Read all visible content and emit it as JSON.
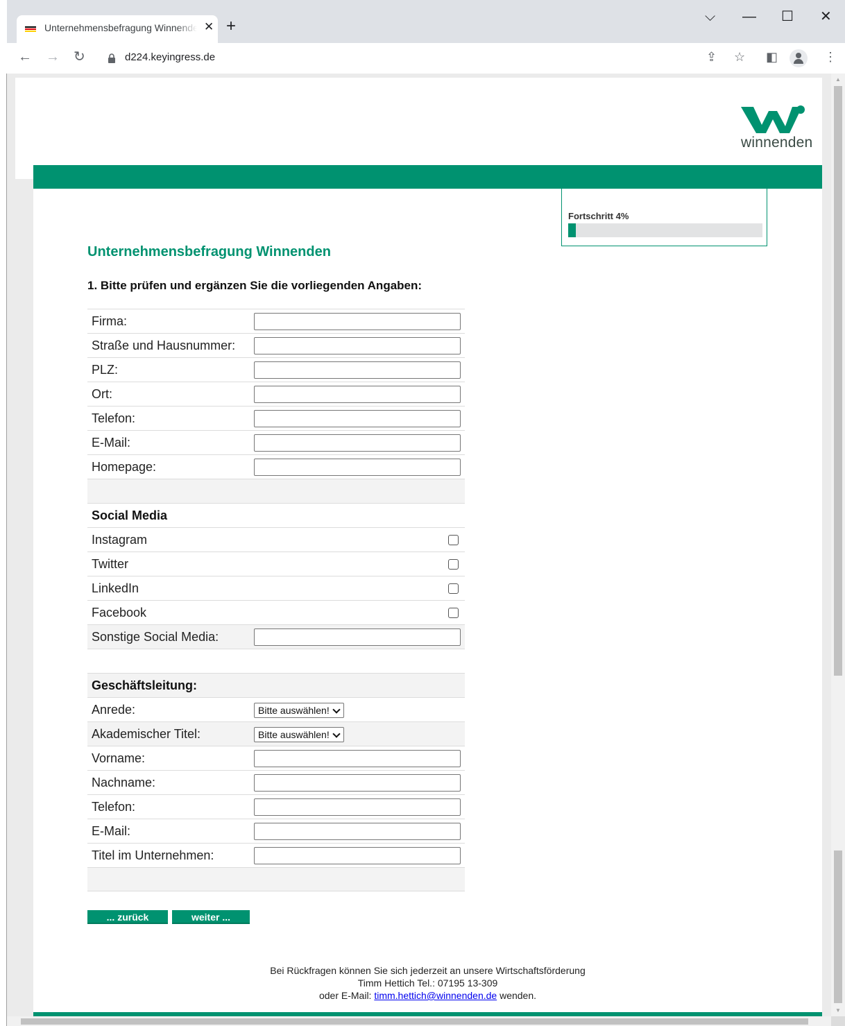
{
  "browser": {
    "tab_title": "Unternehmensbefragung Winnenden",
    "tab_close": "✕",
    "new_tab": "+",
    "url": "d224.keyingress.de",
    "window_controls": {
      "dropdown": "⌵",
      "minimize": "—",
      "maximize": "☐",
      "close": "✕"
    },
    "nav": {
      "back": "←",
      "forward": "→",
      "reload": "↻"
    },
    "toolbar_icons": {
      "share": "⇪",
      "bookmark": "☆",
      "sidepanel": "◧",
      "menu": "⋮"
    }
  },
  "logo": {
    "text": "winnenden",
    "icon": "winnenden-w-logo",
    "color": "#009270"
  },
  "progress": {
    "label": "Fortschritt 4%",
    "value": 0.04
  },
  "survey_title": "Unternehmensbefragung Winnenden",
  "question": "1. Bitte prüfen und ergänzen Sie die vorliegenden Angaben:",
  "company": {
    "fields": [
      "Firma:",
      "Straße und Hausnummer:",
      "PLZ:",
      "Ort:",
      "Telefon:",
      "E-Mail:",
      "Homepage:"
    ]
  },
  "social": {
    "heading": "Social Media",
    "checkboxes": [
      "Instagram",
      "Twitter",
      "LinkedIn",
      "Facebook"
    ],
    "other_label": "Sonstige Social Media:"
  },
  "management": {
    "heading": "Geschäftsleitung:",
    "salutation_label": "Anrede:",
    "title_label": "Akademischer Titel:",
    "select_placeholder": "Bitte auswählen!",
    "fields": [
      "Vorname:",
      "Nachname:",
      "Telefon:",
      "E-Mail:",
      "Titel im Unternehmen:"
    ]
  },
  "buttons": {
    "back": "... zurück",
    "next": "weiter ..."
  },
  "footer": {
    "line1": "Bei Rückfragen können Sie sich jederzeit an unsere Wirtschaftsförderung",
    "line2": "Timm Hettich Tel.: 07195 13-309",
    "line3_prefix": "oder E-Mail:",
    "email": "timm.hettich@winnenden.de",
    "line3_suffix": "wenden."
  },
  "colors": {
    "accent": "#009270",
    "tab_bar": "#dee1e6",
    "page_bg": "#ebebeb"
  }
}
